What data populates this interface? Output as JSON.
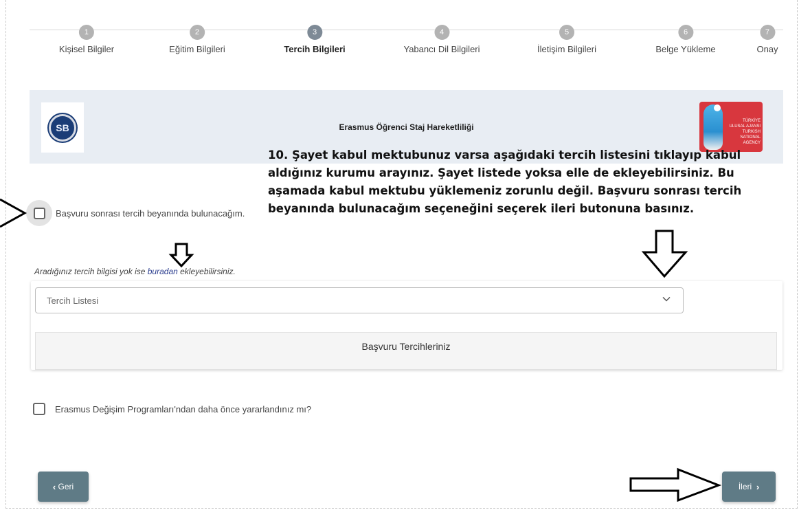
{
  "stepper": {
    "steps": [
      {
        "num": "1",
        "label": "Kişisel Bilgiler"
      },
      {
        "num": "2",
        "label": "Eğitim Bilgileri"
      },
      {
        "num": "3",
        "label": "Tercih Bilgileri"
      },
      {
        "num": "4",
        "label": "Yabancı Dil Bilgileri"
      },
      {
        "num": "5",
        "label": "İletişim Bilgileri"
      },
      {
        "num": "6",
        "label": "Belge Yükleme"
      },
      {
        "num": "7",
        "label": "Onay"
      }
    ],
    "active_index": 2
  },
  "banner": {
    "title": "Erasmus Öğrenci Staj Hareketliliği",
    "left_logo_text": "SB",
    "right_logo_text": "TÜRKİYE ULUSAL AJANSI TURKISH NATIONAL AGENCY"
  },
  "instruction": "10. Şayet kabul mektubunuz varsa aşağıdaki tercih listesini tıklayıp kabul aldığınız kurumu arayınız. Şayet listede yoksa elle de ekleyebilirsiniz. Bu aşamada kabul mektubu yüklemeniz zorunlu değil. Başvuru sonrası tercih beyanında bulunacağım seçeneğini seçerek ileri butonuna basınız.",
  "declare_later": {
    "label": "Başvuru sonrası tercih beyanında bulunacağım.",
    "checked": false
  },
  "hint": {
    "prefix": "Aradığınız tercih bilgisi yok ise ",
    "link": "buradan",
    "suffix": " ekleyebilirsiniz."
  },
  "preference_select": {
    "placeholder": "Tercih Listesi"
  },
  "preferences_panel": {
    "title": "Başvuru Tercihleriniz"
  },
  "erasmus_before": {
    "label": "Erasmus Değişim Programları'ndan daha önce yararlandınız mı?",
    "checked": false
  },
  "buttons": {
    "back": "Geri",
    "next": "İleri"
  },
  "colors": {
    "button": "#5f7b86",
    "banner": "#e8edf3",
    "link": "#2c3e8f"
  }
}
